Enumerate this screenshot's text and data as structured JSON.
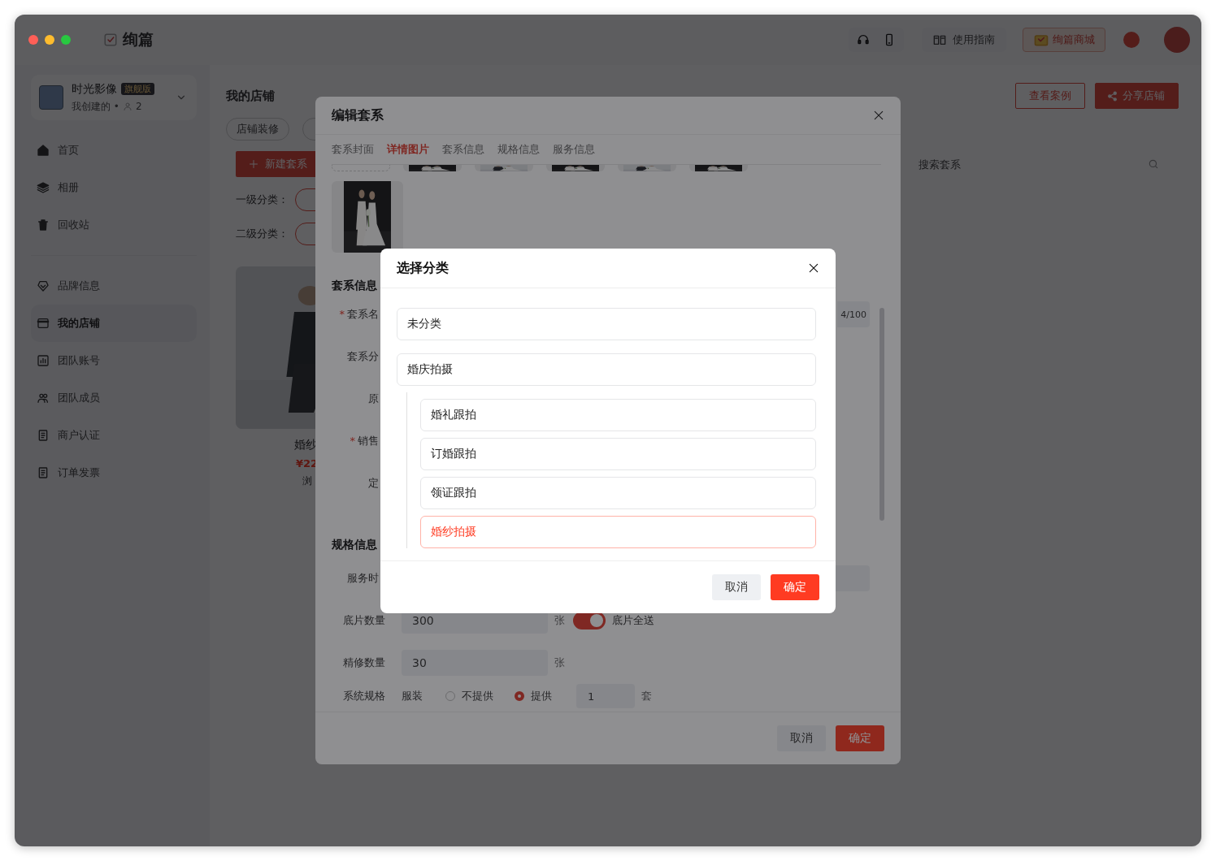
{
  "top_bar": {
    "app_name": "绚篇",
    "guide_label": "使用指南",
    "mall_label": "绚篇商城"
  },
  "sidebar": {
    "workspace": {
      "name": "时光影像",
      "badge": "旗舰版",
      "subtitle": "我创建的 •",
      "member_count": "2"
    },
    "groups": [
      {
        "items": [
          {
            "label": "首页",
            "selected": false
          },
          {
            "label": "相册",
            "selected": false
          },
          {
            "label": "回收站",
            "selected": false
          }
        ]
      },
      {
        "items": [
          {
            "label": "品牌信息",
            "selected": false
          },
          {
            "label": "我的店铺",
            "selected": true
          },
          {
            "label": "团队账号",
            "selected": false
          },
          {
            "label": "团队成员",
            "selected": false
          },
          {
            "label": "商户认证",
            "selected": false
          },
          {
            "label": "订单发票",
            "selected": false
          }
        ]
      }
    ]
  },
  "page": {
    "title": "我的店铺",
    "chips": [
      "店铺装修"
    ],
    "actions": [
      {
        "label": "查看案例",
        "kind": "outline"
      },
      {
        "label": "分享店铺",
        "kind": "share"
      }
    ],
    "new_button": "新建套系",
    "search": {
      "placeholder": "搜索套系"
    },
    "filters": [
      {
        "label": "一级分类："
      },
      {
        "label": "二级分类："
      }
    ],
    "package_card": {
      "kind": "picture",
      "title": "婚纱",
      "price": "¥22",
      "meta": "浏"
    }
  },
  "edit_dialog": {
    "title": "编辑套系",
    "tabs": [
      {
        "label": "套系封面",
        "selected": false
      },
      {
        "label": "详情图片",
        "selected": true
      },
      {
        "label": "套系信息",
        "selected": false
      },
      {
        "label": "规格信息",
        "selected": false
      },
      {
        "label": "服务信息",
        "selected": false
      }
    ],
    "section_1": "套系信息",
    "rows": [
      {
        "label": "套系名",
        "required_mark": "*",
        "counter": "4/100"
      },
      {
        "label": "套系分"
      },
      {
        "label": "原"
      },
      {
        "label": "销售",
        "required_mark": "*"
      },
      {
        "label": "定"
      }
    ],
    "section_2": "规格信息",
    "service_time": {
      "label": "服务时"
    },
    "negatives": {
      "label": "底片数量",
      "value": "300",
      "unit": "张",
      "toggle_on": true,
      "toggle_label": "底片全送"
    },
    "retouch": {
      "label": "精修数量",
      "value": "30",
      "unit": "张"
    },
    "spec": {
      "label": "系统规格",
      "item": "服装",
      "options": [
        {
          "label": "不提供",
          "selected": false
        },
        {
          "label": "提供",
          "selected": true
        }
      ],
      "value": "1",
      "unit": "套"
    },
    "buttons": [
      {
        "label": "取消",
        "kind": "secondary"
      },
      {
        "label": "确定",
        "kind": "primary"
      }
    ]
  },
  "category_dialog": {
    "title": "选择分类",
    "options": [
      {
        "label": "未分类",
        "selected": false
      },
      {
        "label": "婚庆拍摄",
        "selected": false,
        "children": [
          {
            "label": "婚礼跟拍",
            "selected": false
          },
          {
            "label": "订婚跟拍",
            "selected": false
          },
          {
            "label": "领证跟拍",
            "selected": false
          },
          {
            "label": "婚纱拍摄",
            "selected": true
          }
        ]
      }
    ],
    "buttons": [
      {
        "label": "取消",
        "kind": "secondary"
      },
      {
        "label": "确定",
        "kind": "primary"
      }
    ]
  }
}
